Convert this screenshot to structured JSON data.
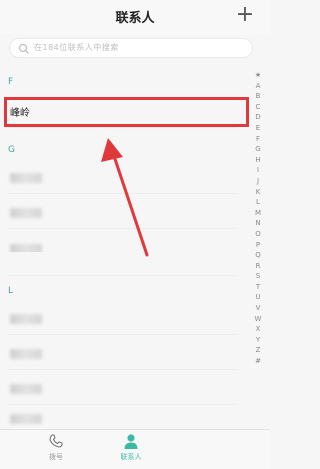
{
  "header": {
    "title": "联系人",
    "add_symbol": "+"
  },
  "search": {
    "placeholder": "在184位联系人中搜索"
  },
  "sections": [
    {
      "letter": "F",
      "contacts": [
        "峰岭"
      ]
    },
    {
      "letter": "G",
      "contacts": [
        "",
        "",
        "",
        ""
      ]
    },
    {
      "letter": "L",
      "contacts": [
        "",
        "",
        "",
        ""
      ]
    }
  ],
  "alphabet": [
    "★",
    "A",
    "B",
    "C",
    "D",
    "E",
    "F",
    "G",
    "H",
    "I",
    "J",
    "K",
    "L",
    "M",
    "N",
    "O",
    "P",
    "Q",
    "R",
    "S",
    "T",
    "U",
    "V",
    "W",
    "X",
    "Y",
    "Z",
    "#"
  ],
  "tabs": [
    {
      "label": "拨号",
      "icon": "phone-icon",
      "active": false
    },
    {
      "label": "联系人",
      "icon": "person-icon",
      "active": true
    }
  ],
  "colors": {
    "accent": "#3cb9a5",
    "highlight": "#e0393b",
    "section_letter": "#4aa3a0"
  }
}
